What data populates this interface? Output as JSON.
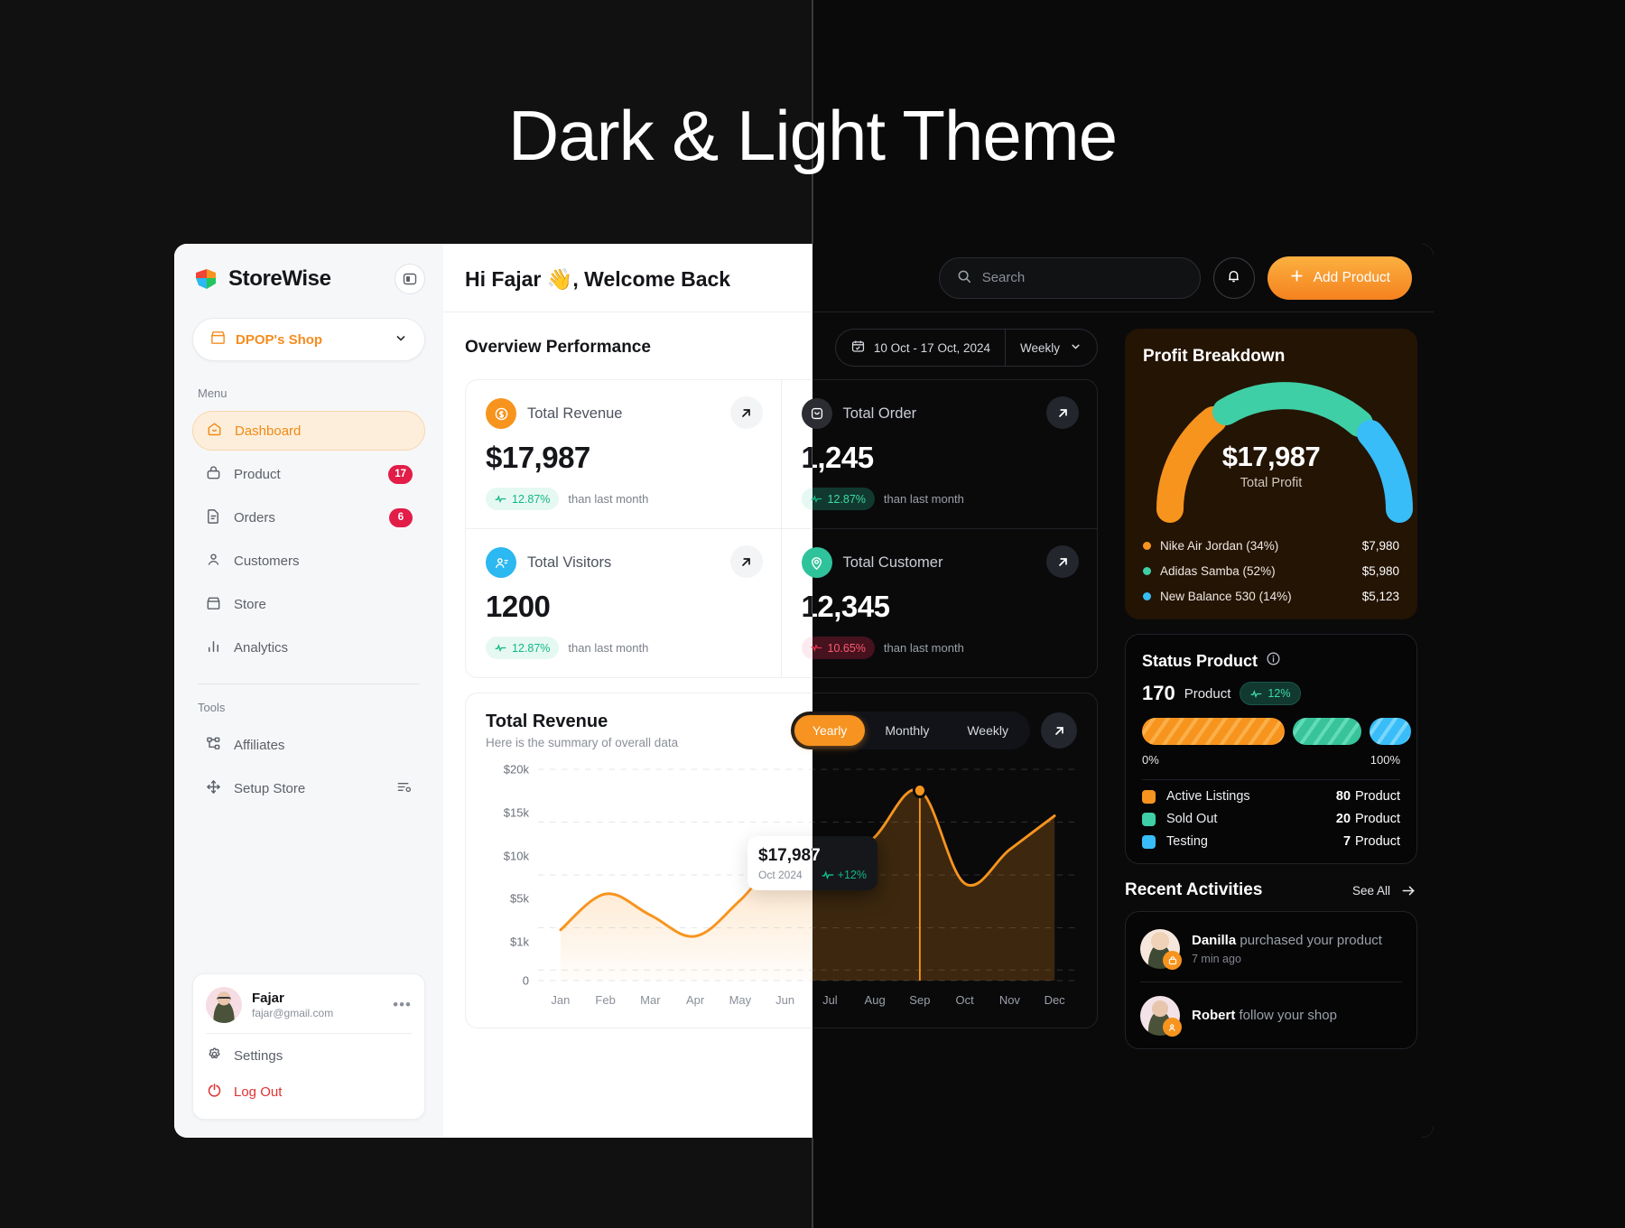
{
  "headline": "Dark & Light Theme",
  "brand": {
    "name": "StoreWise"
  },
  "sidebar": {
    "shop": {
      "label": "DPOP's Shop"
    },
    "menu_label": "Menu",
    "tools_label": "Tools",
    "menu": [
      {
        "label": "Dashboard",
        "icon": "home-icon",
        "badge": ""
      },
      {
        "label": "Product",
        "icon": "bag-icon",
        "badge": "17"
      },
      {
        "label": "Orders",
        "icon": "document-icon",
        "badge": "6"
      },
      {
        "label": "Customers",
        "icon": "users-icon",
        "badge": ""
      },
      {
        "label": "Store",
        "icon": "store-icon",
        "badge": ""
      },
      {
        "label": "Analytics",
        "icon": "bar-chart-icon",
        "badge": ""
      }
    ],
    "tools": [
      {
        "label": "Affiliates",
        "icon": "hierarchy-icon"
      },
      {
        "label": "Setup Store",
        "icon": "move-icon"
      }
    ],
    "user": {
      "name": "Fajar",
      "email": "fajar@gmail.com",
      "settings_label": "Settings",
      "logout_label": "Log Out"
    }
  },
  "header": {
    "greeting": "Hi Fajar 👋, Welcome Back",
    "search_placeholder": "Search",
    "add_product_label": "Add Product"
  },
  "overview": {
    "title": "Overview Performance",
    "date_range": "10 Oct - 17 Oct, 2024",
    "period": "Weekly",
    "stats": [
      {
        "label": "Total Revenue",
        "value": "$17,987",
        "delta": "12.87%",
        "dir": "up",
        "note": "than last month",
        "color": "#f7941e"
      },
      {
        "label": "Total Order",
        "value": "1,245",
        "delta": "12.87%",
        "dir": "up",
        "note": "than last month",
        "color": "#2b2d33"
      },
      {
        "label": "Total Visitors",
        "value": "1200",
        "delta": "12.87%",
        "dir": "up",
        "note": "than last month",
        "color": "#2cb8f0"
      },
      {
        "label": "Total Customer",
        "value": "12,345",
        "delta": "10.65%",
        "dir": "down",
        "note": "than last month",
        "color": "#2fc39b"
      }
    ]
  },
  "revenue": {
    "title": "Total Revenue",
    "subtitle": "Here is the summary of overall data",
    "tabs": [
      {
        "label": "Yearly",
        "active": true
      },
      {
        "label": "Monthly",
        "active": false
      },
      {
        "label": "Weekly",
        "active": false
      }
    ],
    "tooltip": {
      "value": "$17,987",
      "date": "Oct 2024",
      "change": "+12%"
    }
  },
  "profit": {
    "title": "Profit Breakdown",
    "total_value": "$17,987",
    "total_caption": "Total Profit",
    "items": [
      {
        "label": "Nike Air Jordan  (34%)",
        "amount": "$7,980",
        "color": "#f7941e"
      },
      {
        "label": "Adidas Samba (52%)",
        "amount": "$5,980",
        "color": "#3fcfa6"
      },
      {
        "label": "New Balance 530 (14%)",
        "amount": "$5,123",
        "color": "#38bdf8"
      }
    ]
  },
  "status": {
    "title": "Status Product",
    "count": "170",
    "unit": "Product",
    "delta": "12%",
    "scale_min": "0%",
    "scale_max": "100%",
    "items": [
      {
        "label": "Active Listings",
        "value": "80",
        "unit": "Product",
        "color": "#f7941e"
      },
      {
        "label": "Sold Out",
        "value": "20",
        "unit": "Product",
        "color": "#3fcfa6"
      },
      {
        "label": "Testing",
        "value": "7",
        "unit": "Product",
        "color": "#38bdf8"
      }
    ]
  },
  "activities": {
    "title": "Recent Activities",
    "see_all": "See All",
    "items": [
      {
        "user": "Danilla",
        "action": "purchased your product",
        "time": "7 min ago"
      },
      {
        "user": "Robert",
        "action": "follow your shop",
        "time": ""
      }
    ]
  },
  "chart_data": {
    "type": "area",
    "title": "Total Revenue",
    "xlabel": "",
    "ylabel": "",
    "categories": [
      "Jan",
      "Feb",
      "Mar",
      "Apr",
      "May",
      "Jun",
      "Jul",
      "Aug",
      "Sep",
      "Oct",
      "Nov",
      "Dec"
    ],
    "ytick_labels": [
      "$20k",
      "$15k",
      "$10k",
      "$5k",
      "$1k",
      "0"
    ],
    "ytick_values": [
      20000,
      15000,
      10000,
      5000,
      1000,
      0
    ],
    "ylim": [
      0,
      20000
    ],
    "values": [
      4800,
      8200,
      6200,
      4200,
      7600,
      11800,
      9600,
      13600,
      17987,
      9200,
      12400,
      15600
    ],
    "highlight_index": 8,
    "highlight_value": 17987,
    "grid": true,
    "legend": "none",
    "series_color": "#f7941e"
  }
}
